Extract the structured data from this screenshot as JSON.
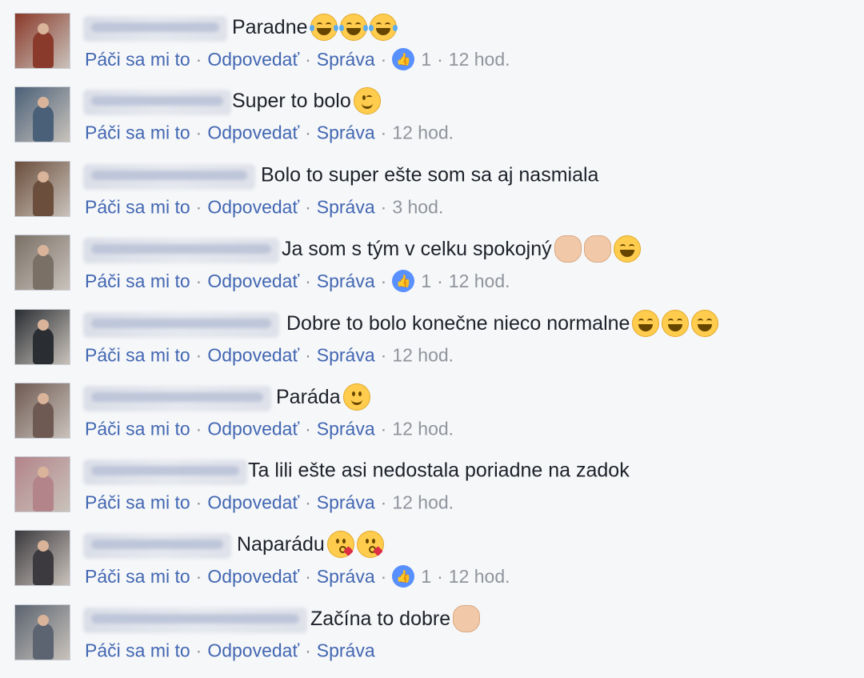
{
  "actions": {
    "like": "Páči sa mi to",
    "reply": "Odpovedať",
    "message": "Správa"
  },
  "comments": [
    {
      "text": "Paradne",
      "emojis": [
        "laugh-tears",
        "laugh-tears",
        "laugh-tears"
      ],
      "likes": "1",
      "time": "12 hod.",
      "avatar_color": "#8a3a2a"
    },
    {
      "text": "Super to bolo",
      "emojis": [
        "wink"
      ],
      "likes": "",
      "time": "12 hod.",
      "avatar_color": "#4a6078"
    },
    {
      "text": "Bolo to super ešte som sa aj nasmiala",
      "emojis": [],
      "likes": "",
      "time": "3 hod.",
      "avatar_color": "#6b4e3c"
    },
    {
      "text": "Ja som s tým v celku spokojný",
      "emojis": [
        "ok-hand",
        "clap",
        "grin"
      ],
      "likes": "1",
      "time": "12 hod.",
      "avatar_color": "#7a7066"
    },
    {
      "text": "Dobre to bolo konečne nieco normalne",
      "emojis": [
        "grin",
        "grin",
        "grin"
      ],
      "likes": "",
      "time": "12 hod.",
      "avatar_color": "#2a2e33"
    },
    {
      "text": "Paráda",
      "emojis": [
        "smile"
      ],
      "likes": "",
      "time": "12 hod.",
      "avatar_color": "#6e5a52"
    },
    {
      "text": "Ta lili ešte asi nedostala poriadne na zadok",
      "emojis": [],
      "likes": "",
      "time": "12 hod.",
      "avatar_color": "#b3848a"
    },
    {
      "text": "Naparádu",
      "emojis": [
        "kiss-heart",
        "kiss-heart"
      ],
      "likes": "1",
      "time": "12 hod.",
      "avatar_color": "#3c3a3e"
    },
    {
      "text": "Začína to dobre",
      "emojis": [
        "ok-hand"
      ],
      "likes": "",
      "time": "",
      "avatar_color": "#5b6470"
    }
  ],
  "colors": {
    "link": "#4267b2",
    "meta": "#90949c",
    "like_badge": "#5890ff",
    "background": "#f6f7f9"
  }
}
